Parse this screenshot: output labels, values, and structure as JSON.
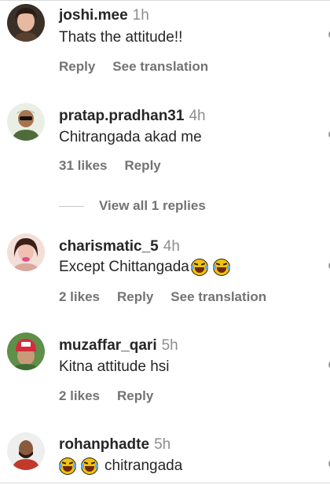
{
  "comments": [
    {
      "username": "joshi.mee",
      "time": "1h",
      "text": "Thats the attitude!!",
      "actions": {
        "likes": "",
        "reply": "Reply",
        "translate": "See translation"
      },
      "avatar_color": "#6b4a3a"
    },
    {
      "username": "pratap.pradhan31",
      "time": "4h",
      "text": "Chitrangada akad me",
      "actions": {
        "likes": "31 likes",
        "reply": "Reply",
        "translate": ""
      },
      "avatar_color": "#4a6a3a"
    },
    {
      "username": "charismatic_5",
      "time": "4h",
      "text": "Except Chittangada",
      "actions": {
        "likes": "2 likes",
        "reply": "Reply",
        "translate": "See translation"
      },
      "avatar_color": "#c98a7a"
    },
    {
      "username": "muzaffar_qari",
      "time": "5h",
      "text": "Kitna attitude hsi",
      "actions": {
        "likes": "2 likes",
        "reply": "Reply",
        "translate": ""
      },
      "avatar_color": "#c0392b"
    },
    {
      "username": "rohanphadte",
      "time": "5h",
      "text": "chitrangada",
      "actions": {
        "likes": "",
        "reply": "",
        "translate": ""
      },
      "avatar_color": "#c0392b"
    }
  ],
  "view_replies": "View all 1 replies",
  "colors": {
    "text": "#262626",
    "muted": "#737373",
    "time": "#8e8e8e"
  },
  "icons": {
    "like": "heart-icon",
    "emoji": "joy-emoji-icon"
  }
}
